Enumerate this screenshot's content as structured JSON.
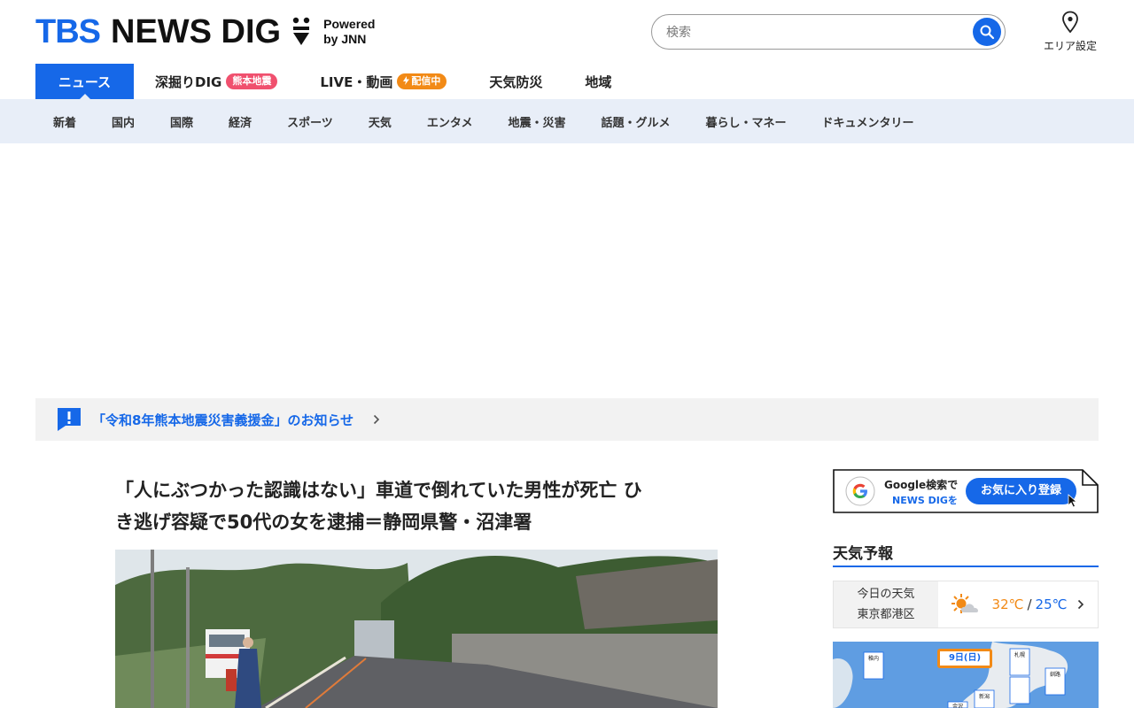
{
  "header": {
    "logo_tbs": "TBS",
    "logo_news": "NEWS DIG",
    "powered_line1": "Powered",
    "powered_line2": "by JNN",
    "search_placeholder": "検索",
    "area_label": "エリア設定"
  },
  "main_nav": [
    {
      "label": "ニュース",
      "active": true
    },
    {
      "label": "深掘りDIG",
      "badge": "熊本地震",
      "badge_color": "#f0506e"
    },
    {
      "label": "LIVE・動画",
      "badge": "配信中",
      "badge_color": "#f28a16"
    },
    {
      "label": "天気防災"
    },
    {
      "label": "地域"
    }
  ],
  "sub_nav": [
    "新着",
    "国内",
    "国際",
    "経済",
    "スポーツ",
    "天気",
    "エンタメ",
    "地震・災害",
    "話題・グルメ",
    "暮らし・マネー",
    "ドキュメンタリー"
  ],
  "notice": {
    "text": "「令和8年熊本地震災害義援金」のお知らせ"
  },
  "article": {
    "title_line1": "「人にぶつかった認識はない」車道で倒れていた男性が死亡 ひ",
    "title_line2": "き逃げ容疑で50代の女を逮捕＝静岡県警・沼津署"
  },
  "sidebar": {
    "google_line1": "Google検索で",
    "google_line2": "NEWS DIGを",
    "google_button": "お気に入り登録",
    "weather_heading": "天気予報",
    "weather_today": "今日の天気",
    "weather_location": "東京都港区",
    "temp_high": "32℃",
    "temp_sep": "/",
    "temp_low": "25℃",
    "map_date": "9日(日)",
    "map_cities": [
      "稚内",
      "札幌",
      "釧路",
      "新潟",
      "金沢"
    ]
  },
  "colors": {
    "brand_blue": "#1668e8",
    "subnav_bg": "#e8eef8",
    "badge_red": "#f0506e",
    "badge_orange": "#f28a16"
  }
}
